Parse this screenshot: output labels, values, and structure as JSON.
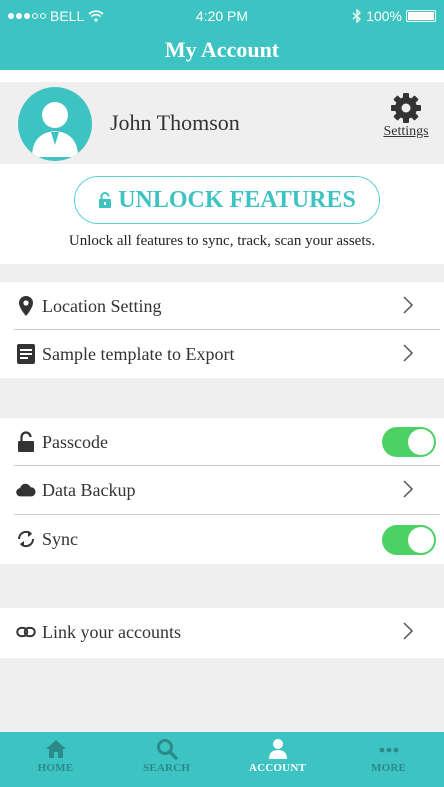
{
  "status_bar": {
    "carrier": "BELL",
    "time": "4:20 PM",
    "battery": "100%"
  },
  "header": {
    "title": "My Account"
  },
  "profile": {
    "name": "John Thomson",
    "settings_label": "Settings"
  },
  "unlock": {
    "button_label": "UNLOCK FEATURES",
    "description": "Unlock all features to sync, track, scan your assets."
  },
  "menu": {
    "location": "Location Setting",
    "template": "Sample template to Export",
    "passcode": "Passcode",
    "passcode_on": true,
    "backup": "Data Backup",
    "sync": "Sync",
    "sync_on": true,
    "link": "Link your accounts"
  },
  "tabs": [
    {
      "label": "HOME",
      "icon": "home-icon",
      "active": false
    },
    {
      "label": "SEARCH",
      "icon": "search-icon",
      "active": false
    },
    {
      "label": "ACCOUNT",
      "icon": "user-icon",
      "active": true
    },
    {
      "label": "MORE",
      "icon": "more-icon",
      "active": false
    }
  ],
  "colors": {
    "accent": "#3ec3c3",
    "toggle_on": "#4cd264",
    "section_gap": "#efefef"
  }
}
